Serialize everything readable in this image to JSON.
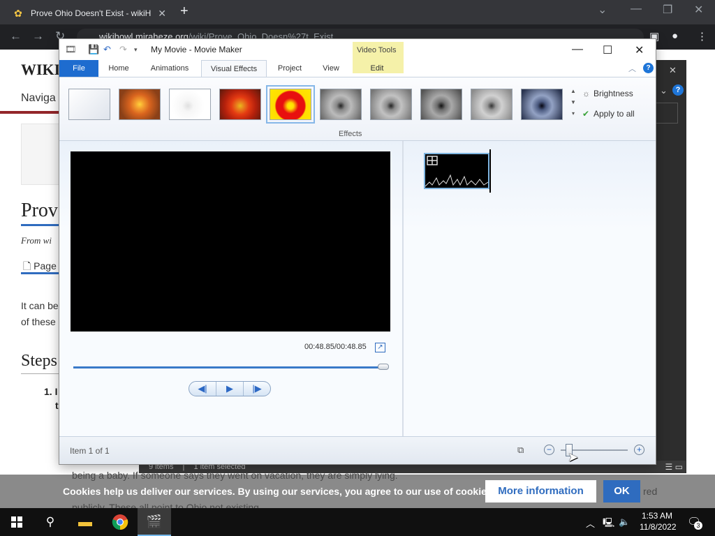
{
  "browser": {
    "tab_title": "Prove Ohio Doesn't Exist - wikiH",
    "url_host": "wikihowl.miraheze.org",
    "url_path": "/wiki/Prove_Ohio_Doesn%27t_Exist"
  },
  "wiki": {
    "brand": "WIKI",
    "nav": "Naviga",
    "heading": "Prove",
    "from": "From wi",
    "page_tab": "Page",
    "text_line1": "It can be",
    "text_line2": "of these",
    "steps_heading": "Steps",
    "step_num": "1.",
    "step_text": "I",
    "step_text2": "t"
  },
  "bg_statusbar": {
    "items_count": "9 items",
    "selected": "1 item selected"
  },
  "cookie": {
    "underlay_line1": "being a baby. If someone says they went on vacation, they are simply lying.",
    "underlay_line2": "publicly. These all point to Ohio not existing.",
    "underlay_tail": "red",
    "message": "Cookies help us deliver our services. By using our services, you agree to our use of cookies.",
    "more_info": "More information",
    "ok": "OK"
  },
  "moviemaker": {
    "title": "My Movie - Movie Maker",
    "contextual_tab": "Video Tools",
    "tabs": [
      "File",
      "Home",
      "Animations",
      "Visual Effects",
      "Project",
      "View",
      "Edit"
    ],
    "active_tab": "Visual Effects",
    "effects_group_label": "Effects",
    "brightness": "Brightness",
    "apply_to_all": "Apply to all",
    "timecode": "00:48.85/00:48.85",
    "playback_progress": 1.0,
    "status_text": "Item 1 of 1",
    "zoom_level": 0.1
  },
  "taskbar": {
    "time": "1:53 AM",
    "date": "11/8/2022",
    "notifications": "3"
  },
  "colors": {
    "accent": "#1e6ccf",
    "contextual_tab": "#f5f1a9",
    "cookie_button": "#2f6cbf"
  }
}
